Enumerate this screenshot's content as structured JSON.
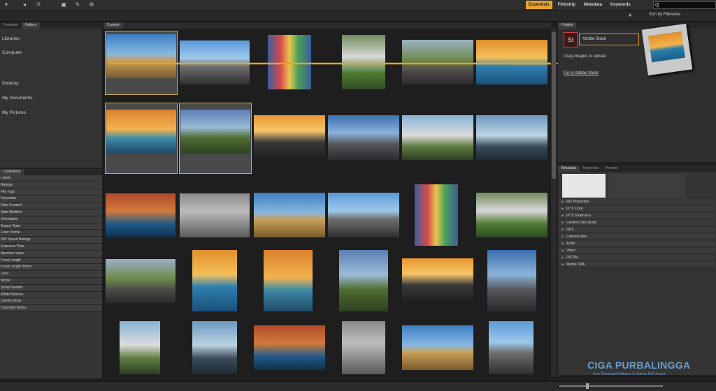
{
  "toolbar": {
    "workspaces": [
      "Essentials",
      "Filmstrip",
      "Metadata",
      "Keywords"
    ],
    "sort_label": "Sort by Filename",
    "search_value": "Q"
  },
  "folders_panel": {
    "tabs": [
      "Favorites",
      "Folders"
    ],
    "items": [
      "Libraries",
      "Computer",
      "Desktop",
      "My Documents",
      "My Pictures"
    ]
  },
  "collections_panel": {
    "tabs": [
      "Collections"
    ],
    "filters": [
      "Labels",
      "Ratings",
      "File Type",
      "Keywords",
      "Date Created",
      "Date Modified",
      "Orientation",
      "Aspect Ratio",
      "Color Profile",
      "ISO Speed Ratings",
      "Exposure Time",
      "Aperture Value",
      "Focal Length",
      "Focal Length 35mm",
      "Lens",
      "Model",
      "Serial Number",
      "White Balance",
      "Camera Raw",
      "Copyright Notice"
    ]
  },
  "content_panel": {
    "tab": "Content"
  },
  "publish_panel": {
    "tab": "Publish",
    "stock_icon": "St",
    "stock_label": "Adobe Stock",
    "drag_text": "Drag images to upload",
    "link_text": "Go to Adobe Stock"
  },
  "metadata_panel": {
    "tabs": [
      "Metadata",
      "Keywords",
      "Preview"
    ],
    "sections": [
      "File Properties",
      "IPTC Core",
      "IPTC Extension",
      "Camera Data (Exif)",
      "GPS",
      "Camera Raw",
      "Audio",
      "Video",
      "DICOM",
      "Mobile SWF"
    ]
  },
  "watermark": {
    "title": "CIGA PURBALINGGA",
    "subtitle": "Free Download Software & Games Full Version"
  },
  "colors": {
    "accent": "#e8a32c",
    "selection": "#c9b04a"
  }
}
